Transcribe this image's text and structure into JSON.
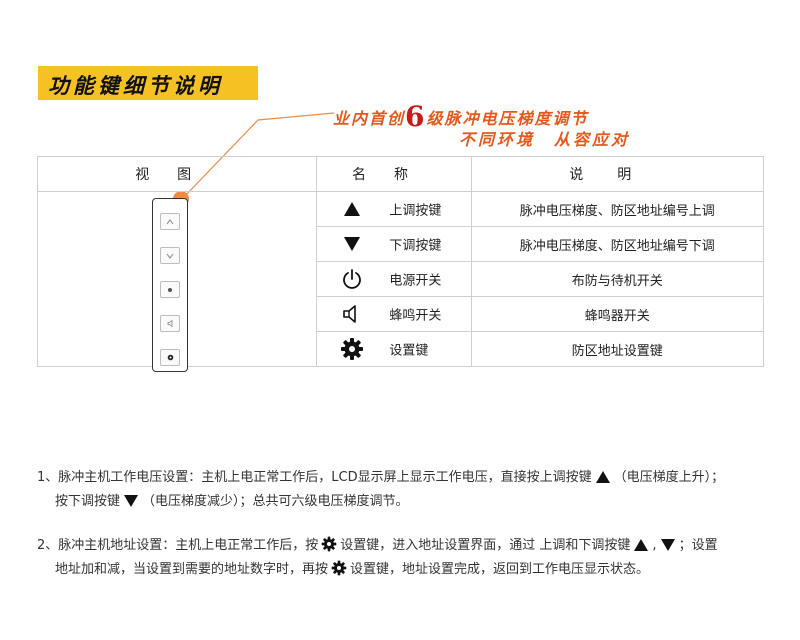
{
  "title": "功能键细节说明",
  "promo": {
    "line1_a": "业内首创",
    "line1_num": "6",
    "line1_b": "级脉冲电压梯度调节",
    "line2": "不同环境　从容应对"
  },
  "table": {
    "headers": {
      "view": "视图",
      "name": "名称",
      "desc": "说明"
    },
    "rows": [
      {
        "icon": "triangle-up-icon",
        "name": "上调按键",
        "desc": "脉冲电压梯度、防区地址编号上调"
      },
      {
        "icon": "triangle-down-icon",
        "name": "下调按键",
        "desc": "脉冲电压梯度、防区地址编号下调"
      },
      {
        "icon": "power-icon",
        "name": "电源开关",
        "desc": "布防与待机开关"
      },
      {
        "icon": "speaker-icon",
        "name": "蜂鸣开关",
        "desc": "蜂鸣器开关"
      },
      {
        "icon": "gear-icon",
        "name": "设置键",
        "desc": "防区地址设置键"
      }
    ]
  },
  "notes": {
    "p1": {
      "l1_a": "1、脉冲主机工作电压设置：主机上电正常工作后，LCD显示屏上显示工作电压，直接按上调按键",
      "l1_b": "（电压梯度上升）；",
      "l2_a": "按下调按键",
      "l2_b": "（电压梯度减少）；总共可六级电压梯度调节。"
    },
    "p2": {
      "l1_a": "2、脉冲主机地址设置：主机上电正常工作后，按",
      "l1_b": "设置键，进入地址设置界面，通过 上调和下调按键",
      "l1_c": ",",
      "l1_d": "；设置",
      "l2_a": "地址加和减，当设置到需要的地址数字时，再按",
      "l2_b": "设置键，地址设置完成，返回到工作电压显示状态。"
    }
  },
  "colors": {
    "title_bg": "#f6c223",
    "promo": "#e8581b",
    "promo_num": "#c81b16",
    "callout": "#f08a43"
  }
}
